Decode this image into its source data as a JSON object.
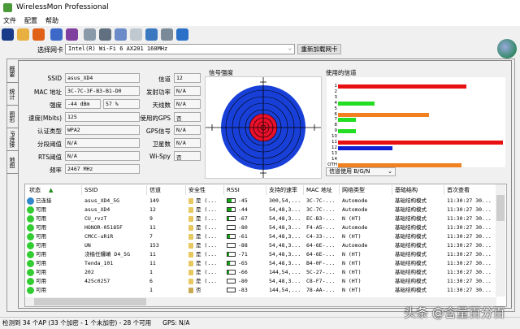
{
  "window": {
    "title": "WirelessMon Professional"
  },
  "menu": [
    "文件",
    "配置",
    "帮助"
  ],
  "toolbar": {
    "icons": [
      "save-icon",
      "open-folder-icon",
      "record-icon",
      "network-icon",
      "network2-icon",
      "export-icon",
      "print-icon",
      "checklist-icon",
      "clipboard-icon",
      "info-globe-icon",
      "info-chat-icon",
      "help-icon"
    ]
  },
  "adapter": {
    "label": "选择网卡",
    "value": "Intel(R) Wi-Fi 6 AX201 160MHz",
    "reload": "重新加载网卡"
  },
  "tabs": [
    "概要",
    "统计",
    "图形",
    "IP连接",
    "地图"
  ],
  "info": {
    "ssid_label": "SSID",
    "ssid": "asus_XD4",
    "mac_label": "MAC 地址",
    "mac": "3C-7C-3F-B3-B1-D0",
    "strength_label": "强度",
    "strength_dbm": "-44 dBm",
    "strength_pct": "57 %",
    "speed_label": "速度(Mbits)",
    "speed": "125",
    "auth_label": "认证类型",
    "auth": "WPA2",
    "frag_label": "分段阈值",
    "frag": "N/A",
    "rts_label": "RTS阈值",
    "rts": "N/A",
    "freq_label": "频率",
    "freq": "2467 MHz",
    "channel_label": "信道",
    "channel": "12",
    "txpower_label": "发射功率",
    "txpower": "N/A",
    "antenna_label": "天线数",
    "antenna": "N/A",
    "gps_used_label": "使用的GPS",
    "gps_used": "否",
    "gps_signal_label": "GPS信号",
    "gps_signal": "N/A",
    "satellites_label": "卫星数",
    "satellites": "N/A",
    "wispy_label": "Wi-Spy",
    "wispy": "否"
  },
  "signal": {
    "title": "信号强度",
    "strength_pct": 57
  },
  "channels": {
    "title": "使用的信道",
    "select": "信道使用 B/G/N",
    "rows": [
      {
        "label": "1",
        "value": 78,
        "color": "#e81010"
      },
      {
        "label": "2",
        "value": 0,
        "color": "#e81010"
      },
      {
        "label": "3",
        "value": 0,
        "color": "#e81010"
      },
      {
        "label": "4",
        "value": 22,
        "color": "#22dd22"
      },
      {
        "label": "5",
        "value": 0,
        "color": "#e81010"
      },
      {
        "label": "6",
        "value": 55,
        "color": "#f08020"
      },
      {
        "label": "7",
        "value": 11,
        "color": "#22dd22"
      },
      {
        "label": "8",
        "value": 0,
        "color": "#e81010"
      },
      {
        "label": "9",
        "value": 11,
        "color": "#22dd22"
      },
      {
        "label": "10",
        "value": 0,
        "color": "#e81010"
      },
      {
        "label": "11",
        "value": 100,
        "color": "#e81010"
      },
      {
        "label": "12",
        "value": 33,
        "color": "#1020d0"
      },
      {
        "label": "13",
        "value": 0,
        "color": "#e81010"
      },
      {
        "label": "14",
        "value": 0,
        "color": "#e81010"
      },
      {
        "label": "OTH",
        "value": 75,
        "color": "#f08020"
      }
    ]
  },
  "table": {
    "headers": [
      "状态",
      "SSID",
      "信道",
      "安全性",
      "RSSI",
      "支持的速率",
      "MAC 地址",
      "网络类型",
      "基础结构",
      "首次查看"
    ],
    "rows": [
      {
        "status": "已连接",
        "connected": true,
        "ssid": "asus_XD4_5G",
        "ch": "149",
        "sec": "是 (...",
        "rssi": "-45",
        "lvl": 60,
        "rate": "300,54,...",
        "mac": "3C-7C-...",
        "type": "Automode",
        "infra": "基础结构模式",
        "seen": "11:30:27 30..."
      },
      {
        "status": "可用",
        "ssid": "asus_XD4",
        "ch": "12",
        "sec": "是 (...",
        "rssi": "-44",
        "lvl": 60,
        "rate": "54,48,3...",
        "mac": "3C-7C-...",
        "type": "Automode",
        "infra": "基础结构模式",
        "seen": "11:30:27 30..."
      },
      {
        "status": "可用",
        "ssid": "CU_rvzT",
        "ch": "9",
        "sec": "是 (...",
        "rssi": "-67",
        "lvl": 25,
        "rate": "54,48,3...",
        "mac": "EC-B3-...",
        "type": "N (HT)",
        "infra": "基础结构模式",
        "seen": "11:30:27 30..."
      },
      {
        "status": "可用",
        "ssid": "HONOR-05185F",
        "ch": "11",
        "sec": "是 (...",
        "rssi": "-80",
        "lvl": 0,
        "rate": "54,48,3...",
        "mac": "F4-A5-...",
        "type": "Automode",
        "infra": "基础结构模式",
        "seen": "11:30:27 30..."
      },
      {
        "status": "可用",
        "ssid": "CMCC-uRiR",
        "ch": "7",
        "sec": "是 (...",
        "rssi": "-61",
        "lvl": 30,
        "rate": "54,48,3...",
        "mac": "C4-33-...",
        "type": "N (HT)",
        "infra": "基础结构模式",
        "seen": "11:30:27 30..."
      },
      {
        "status": "可用",
        "ssid": "UN",
        "ch": "153",
        "sec": "是 (...",
        "rssi": "-88",
        "lvl": 0,
        "rate": "54,48,3...",
        "mac": "64-6E-...",
        "type": "Automode",
        "infra": "基础结构模式",
        "seen": "11:30:27 30..."
      },
      {
        "status": "可用",
        "ssid": "浇樯任鑼嵴 D4_5G",
        "ch": "11",
        "sec": "是 (...",
        "rssi": "-71",
        "lvl": 20,
        "rate": "54,48,3...",
        "mac": "64-6E-...",
        "type": "N (HT)",
        "infra": "基础结构模式",
        "seen": "11:30:27 30..."
      },
      {
        "status": "可用",
        "ssid": "Tenda_101",
        "ch": "11",
        "sec": "是 (...",
        "rssi": "-65",
        "lvl": 30,
        "rate": "54,48,3...",
        "mac": "B4-0F-...",
        "type": "N (HT)",
        "infra": "基础结构模式",
        "seen": "11:30:27 30..."
      },
      {
        "status": "可用",
        "ssid": "202",
        "ch": "1",
        "sec": "是 (...",
        "rssi": "-66",
        "lvl": 25,
        "rate": "144,54,...",
        "mac": "5C-27-...",
        "type": "N (HT)",
        "infra": "基础结构模式",
        "seen": "11:30:27 30..."
      },
      {
        "status": "可用",
        "ssid": "425c0257",
        "ch": "6",
        "sec": "是 (...",
        "rssi": "-80",
        "lvl": 0,
        "rate": "54,48,3...",
        "mac": "C8-F7-...",
        "type": "N (HT)",
        "infra": "基础结构模式",
        "seen": "11:30:27 30..."
      },
      {
        "status": "可用",
        "ssid": "",
        "ch": "1",
        "sec": "否",
        "open": true,
        "rssi": "-83",
        "lvl": 0,
        "rate": "144,54,...",
        "mac": "78-AA-...",
        "type": "N (HT)",
        "infra": "基础结构模式",
        "seen": "11:30:27 30..."
      }
    ]
  },
  "statusbar": {
    "summary": "检测到 34 个AP (33 个加密 - 1 个未加密) - 28 个可用",
    "gps": "GPS: N/A"
  },
  "watermark": "头条 @含量百分百"
}
